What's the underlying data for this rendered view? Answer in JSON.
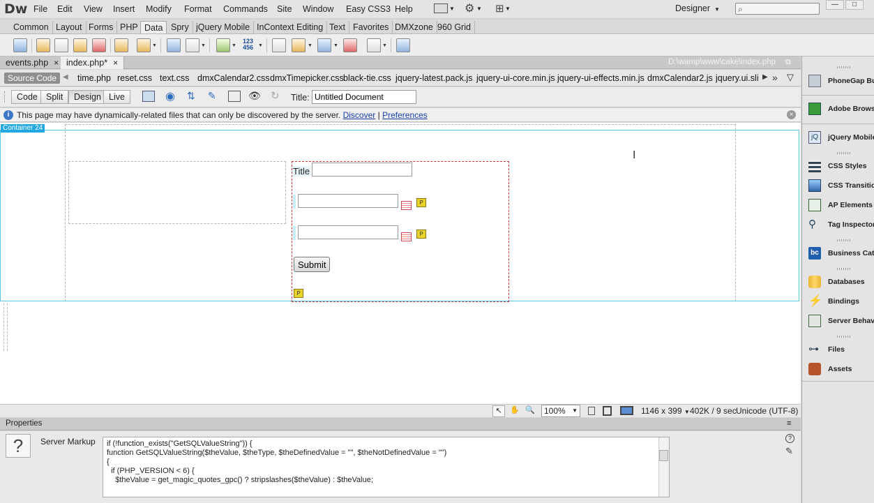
{
  "app": {
    "logo": "Dw",
    "menu": [
      "File",
      "Edit",
      "View",
      "Insert",
      "Modify",
      "Format",
      "Commands",
      "Site",
      "Window",
      "Easy CSS3",
      "Help"
    ],
    "workspace": "Designer",
    "search_placeholder": "⌕"
  },
  "insert_tabs": [
    "Common",
    "Layout",
    "Forms",
    "PHP",
    "Data",
    "Spry",
    "jQuery Mobile",
    "InContext Editing",
    "Text",
    "Favorites",
    "DMXzone",
    "960 Grid"
  ],
  "active_insert_tab": "Data",
  "document_tabs": [
    {
      "label": "events.php",
      "close": "×"
    },
    {
      "label": "index.php*",
      "close": "×"
    }
  ],
  "doc_path": "D:\\wamp\\www\\cake\\index.php",
  "related_files": {
    "source_code": "Source Code",
    "files": [
      "time.php",
      "reset.css",
      "text.css",
      "dmxCalendar2.css",
      "dmxTimepicker.css",
      "black-tie.css",
      "jquery-latest.pack.js",
      "jquery-ui-core.min.js",
      "jquery-ui-effects.min.js",
      "dmxCalendar2.js",
      "jquery.ui.slid"
    ]
  },
  "view_modes": [
    "Code",
    "Split",
    "Design",
    "Live"
  ],
  "active_view": "Design",
  "title": {
    "label": "Title:",
    "value": "Untitled Document"
  },
  "info_bar": {
    "message": "This page may have dynamically-related files that can only be discovered by the server.",
    "discover": "Discover",
    "separator": "|",
    "preferences": "Preferences"
  },
  "canvas": {
    "container_label": "Container 24",
    "form_title_label": "Title",
    "submit_label": "Submit",
    "php_glyph": "P"
  },
  "status": {
    "zoom": "100%",
    "dimensions": "1146 x 399",
    "size_time": "402K / 9 sec",
    "encoding": "Unicode (UTF-8)"
  },
  "properties": {
    "header": "Properties",
    "label": "Server Markup",
    "code_lines": [
      "if (!function_exists(\"GetSQLValueString\")) {",
      "function GetSQLValueString($theValue, $theType, $theDefinedValue = \"\", $theNotDefinedValue = \"\")",
      "{",
      "  if (PHP_VERSION < 6) {",
      "    $theValue = get_magic_quotes_gpc() ? stripslashes($theValue) : $theValue;"
    ]
  },
  "right_panel": [
    {
      "label": "PhoneGap Build",
      "icon": "phonegap-icon"
    },
    {
      "label": "Adobe Browser",
      "icon": "browserlab-icon"
    },
    {
      "label": "jQuery Mobile",
      "icon": "jquery-mobile-icon"
    },
    {
      "label": "CSS Styles",
      "icon": "css-styles-icon"
    },
    {
      "label": "CSS Transitions",
      "icon": "css-transitions-icon"
    },
    {
      "label": "AP Elements",
      "icon": "ap-elements-icon"
    },
    {
      "label": "Tag Inspector",
      "icon": "tag-inspector-icon"
    },
    {
      "label": "Business Catalyst",
      "icon": "business-catalyst-icon"
    },
    {
      "label": "Databases",
      "icon": "databases-icon"
    },
    {
      "label": "Bindings",
      "icon": "bindings-icon"
    },
    {
      "label": "Server Behaviors",
      "icon": "server-behaviors-icon"
    },
    {
      "label": "Files",
      "icon": "files-icon"
    },
    {
      "label": "Assets",
      "icon": "assets-icon"
    }
  ]
}
